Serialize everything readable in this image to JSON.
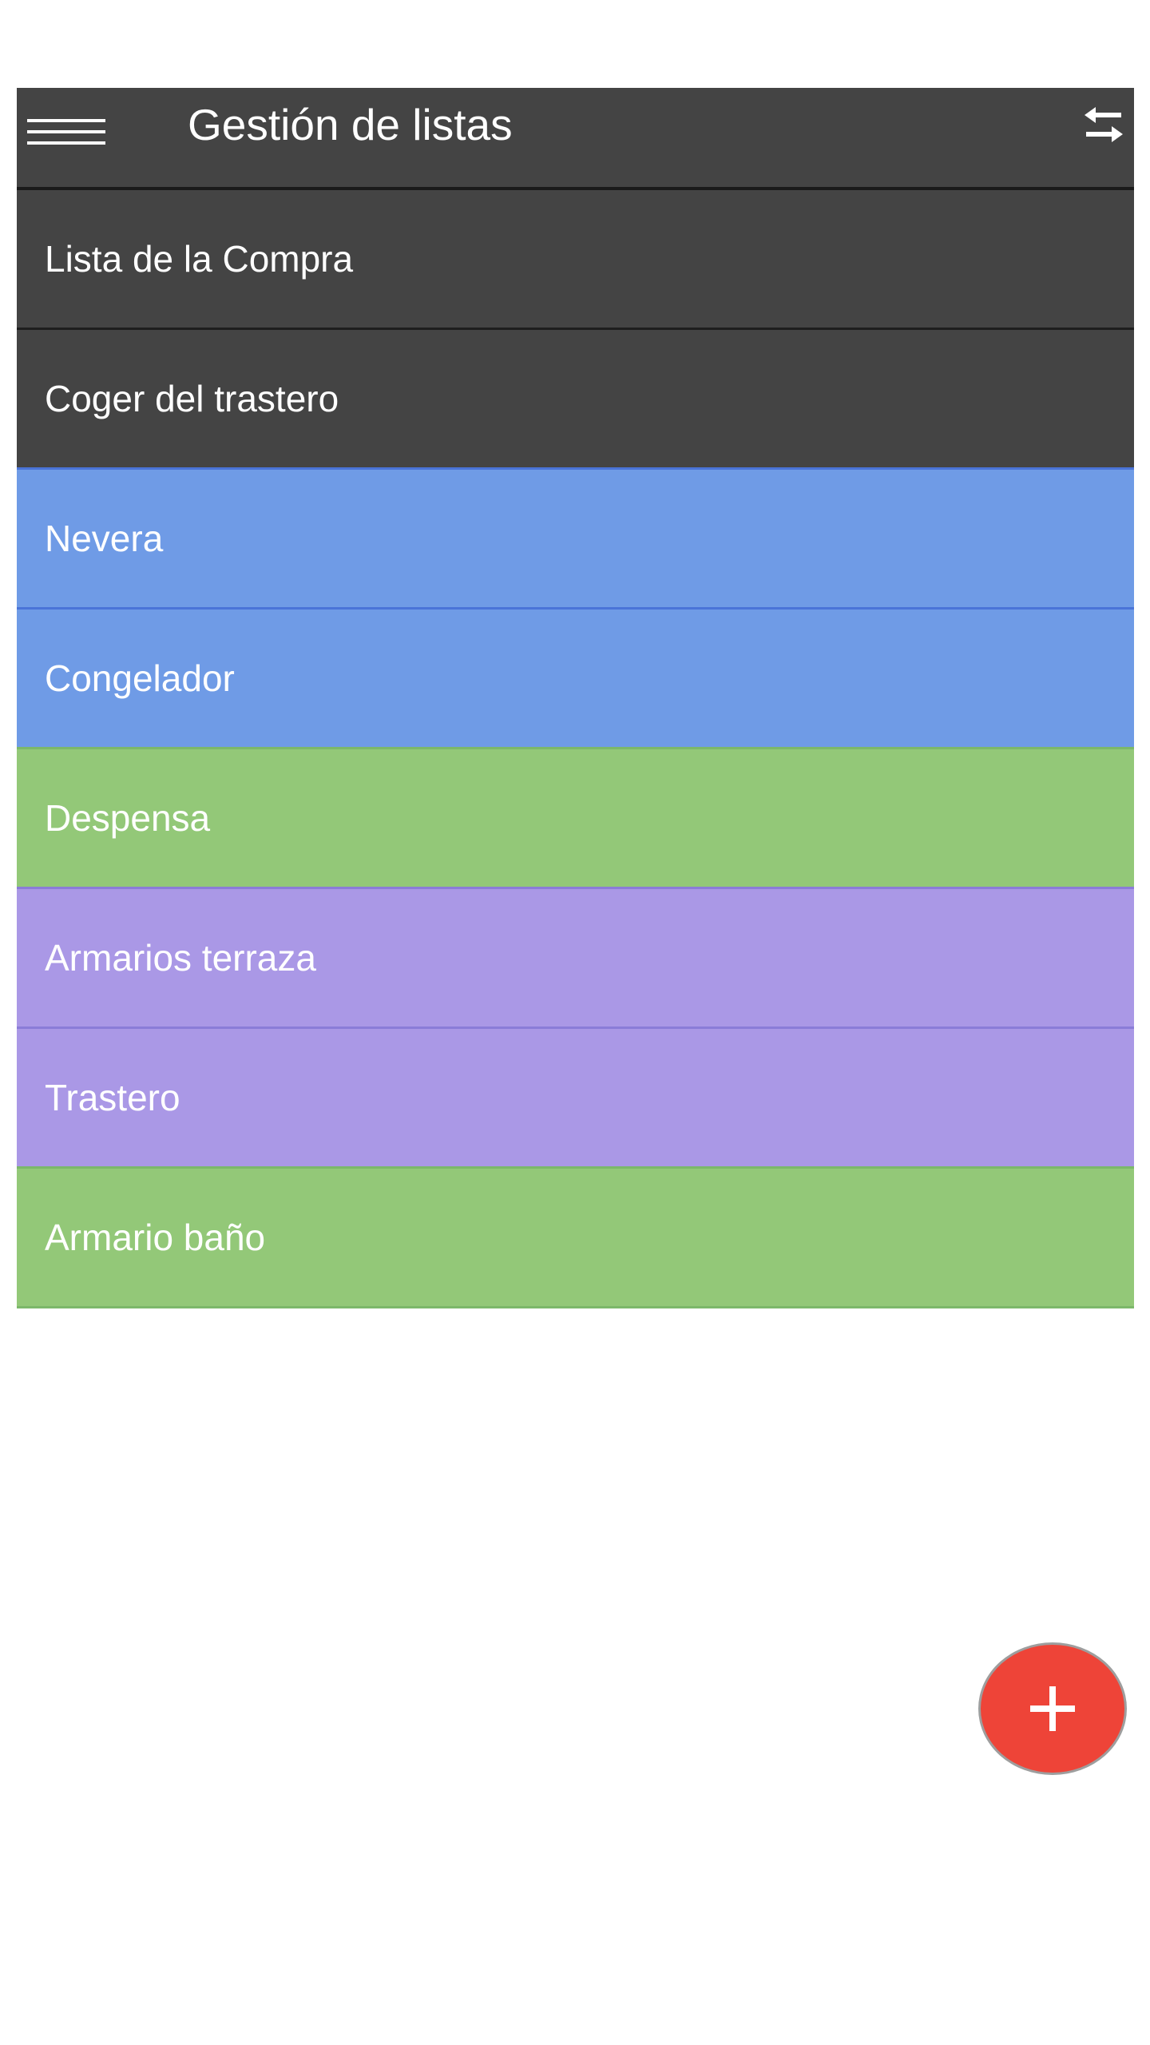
{
  "app": {
    "title": "Gestión de listas",
    "menu_icon": "hamburger-menu-icon",
    "swap_icon": "swap-horiz-icon"
  },
  "lists": [
    {
      "label": "Lista de la Compra",
      "bg": "#444444",
      "border": "#1e1e1e"
    },
    {
      "label": "Coger del trastero",
      "bg": "#444444",
      "border": "#4a74d8"
    },
    {
      "label": "Nevera",
      "bg": "#6f9be6",
      "border": "#4a74d8"
    },
    {
      "label": "Congelador",
      "bg": "#6f9be6",
      "border": "#7cb86a"
    },
    {
      "label": "Despensa",
      "bg": "#93c878",
      "border": "#8a7cd8"
    },
    {
      "label": "Armarios terraza",
      "bg": "#aa98e6",
      "border": "#8a7cd8"
    },
    {
      "label": "Trastero",
      "bg": "#aa98e6",
      "border": "#7cb86a"
    },
    {
      "label": "Armario baño",
      "bg": "#93c878",
      "border": "#7cb86a"
    }
  ],
  "fab": {
    "icon": "plus-icon",
    "color": "#ee4438"
  }
}
